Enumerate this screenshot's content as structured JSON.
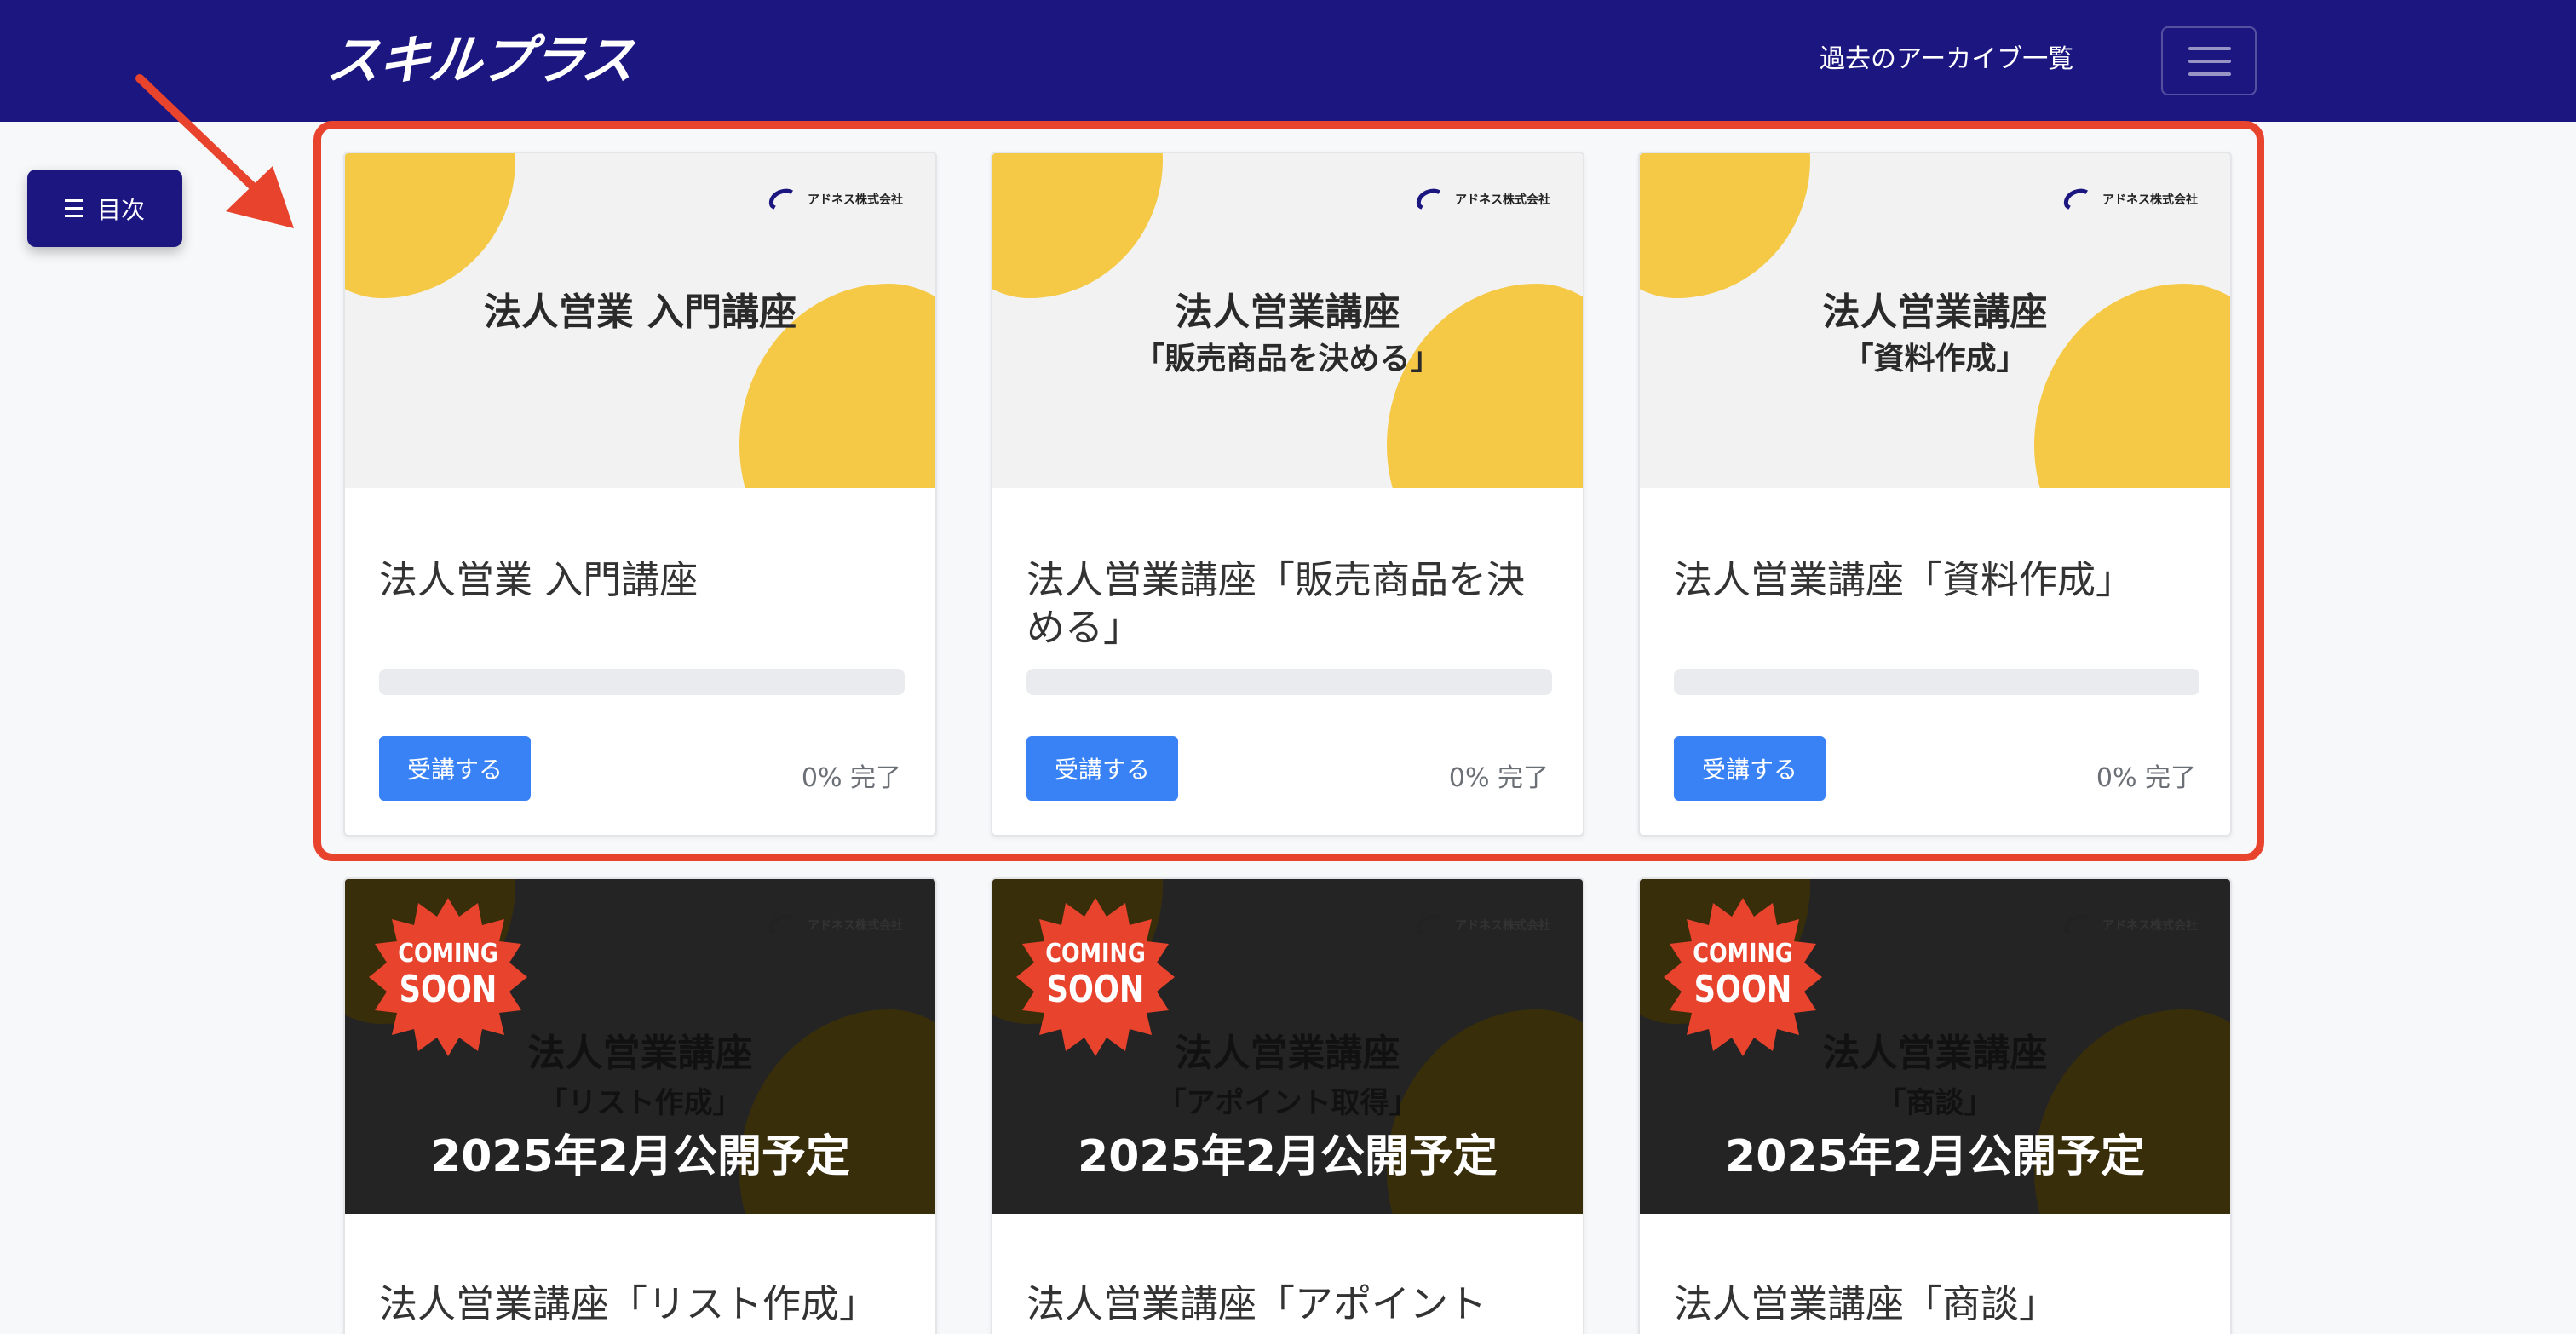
{
  "header": {
    "logo_text": "スキルプラス",
    "archive_link": "過去のアーカイブ一覧"
  },
  "sidebar": {
    "toc_label": "目次"
  },
  "colors": {
    "header_bg": "#1c1680",
    "accent_button": "#3882f6",
    "highlight": "#e8432d",
    "thumb_yellow": "#f5c945",
    "coming_soon_red": "#e8432d"
  },
  "cards": [
    {
      "brand": "アドネス株式会社",
      "thumb_line1": "法人営業 入門講座",
      "thumb_line2": "",
      "title": "法人営業 入門講座",
      "button": "受講する",
      "progress_percent": 0,
      "progress_text": "0% 完了"
    },
    {
      "brand": "アドネス株式会社",
      "thumb_line1": "法人営業講座",
      "thumb_line2": "「販売商品を決める」",
      "title": "法人営業講座「販売商品を決める」",
      "button": "受講する",
      "progress_percent": 0,
      "progress_text": "0% 完了"
    },
    {
      "brand": "アドネス株式会社",
      "thumb_line1": "法人営業講座",
      "thumb_line2": "「資料作成」",
      "title": "法人営業講座「資料作成」",
      "button": "受講する",
      "progress_percent": 0,
      "progress_text": "0% 完了"
    }
  ],
  "upcoming": [
    {
      "brand": "アドネス株式会社",
      "badge_top": "COMING",
      "badge_bottom": "SOON",
      "thumb_line1": "法人営業講座",
      "thumb_line2": "「リスト作成」",
      "thumb_line3": "2025年2月公開予定",
      "title": "法人営業講座「リスト作成」"
    },
    {
      "brand": "アドネス株式会社",
      "badge_top": "COMING",
      "badge_bottom": "SOON",
      "thumb_line1": "法人営業講座",
      "thumb_line2": "「アポイント取得」",
      "thumb_line3": "2025年2月公開予定",
      "title": "法人営業講座「アポイント"
    },
    {
      "brand": "アドネス株式会社",
      "badge_top": "COMING",
      "badge_bottom": "SOON",
      "thumb_line1": "法人営業講座",
      "thumb_line2": "「商談」",
      "thumb_line3": "2025年2月公開予定",
      "title": "法人営業講座「商談」"
    }
  ]
}
